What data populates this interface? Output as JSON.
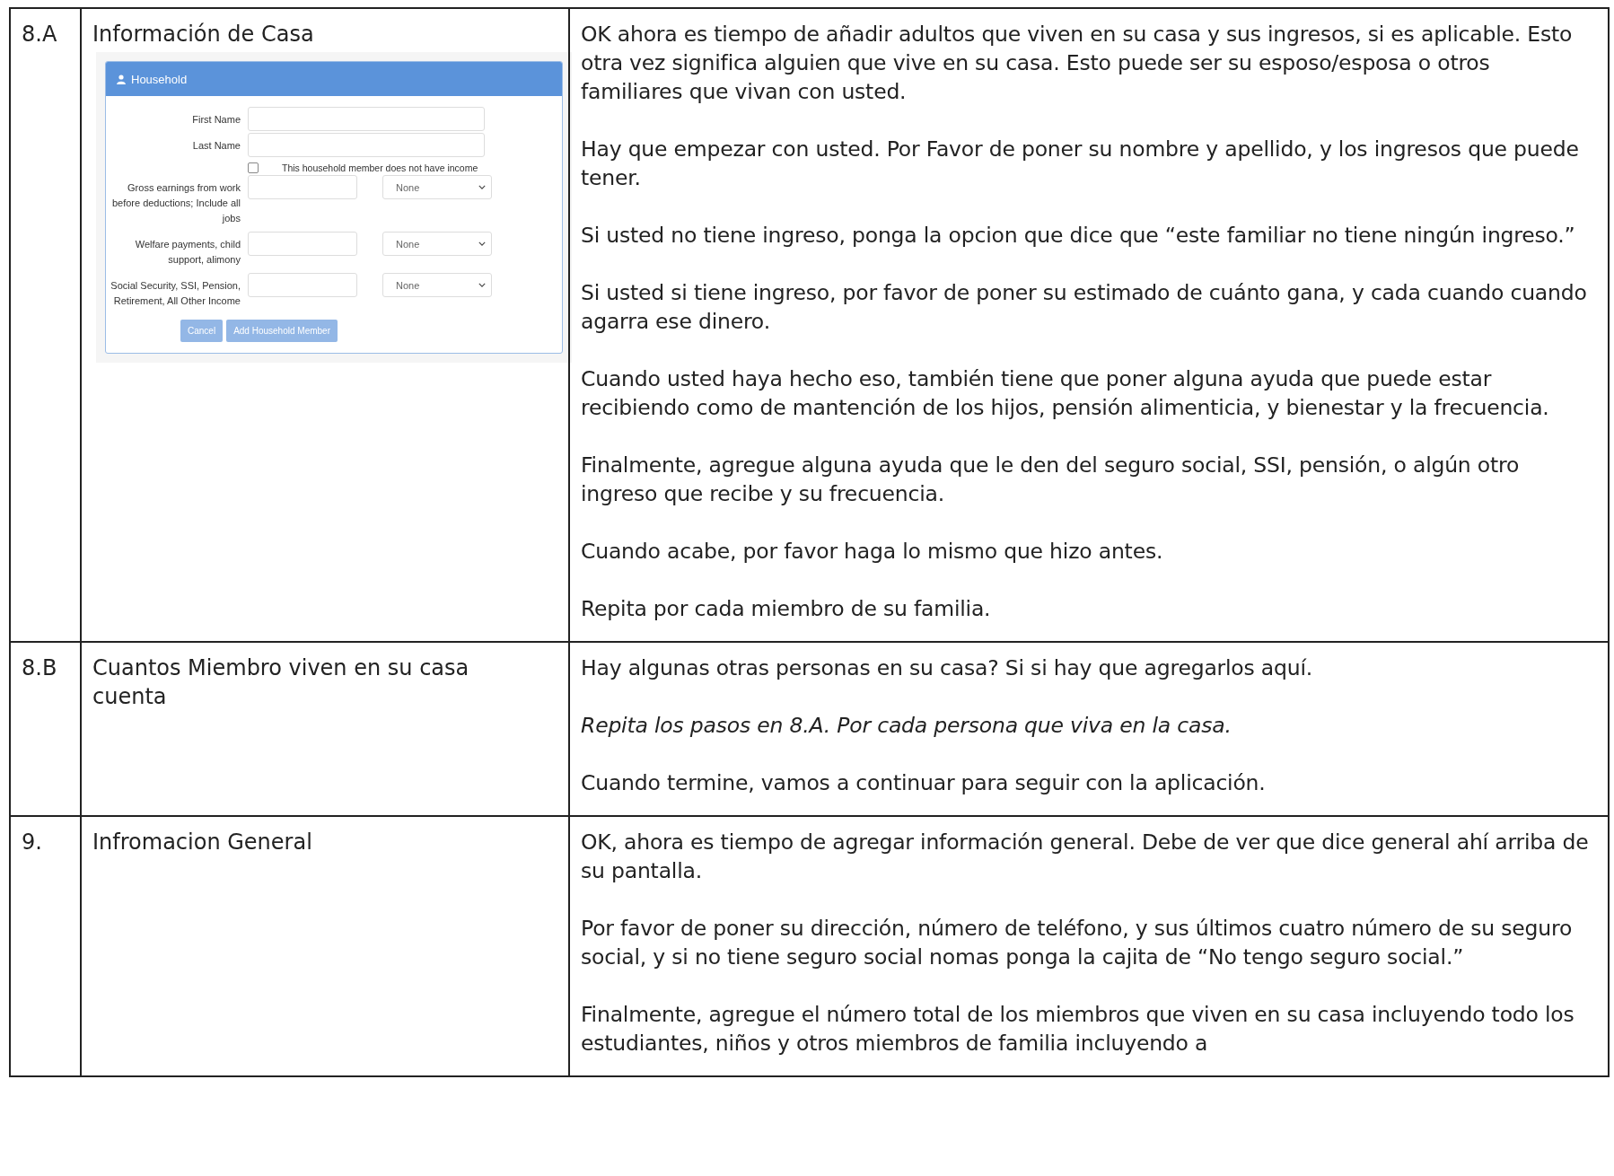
{
  "rows": [
    {
      "number": "8.A",
      "title": "Información de Casa",
      "form": {
        "title": "Household",
        "name_fields": [
          {
            "label": "First Name"
          },
          {
            "label": "Last Name"
          }
        ],
        "no_income_checkbox": {
          "label": "This household member does not have income",
          "checked": false
        },
        "income_fields": [
          {
            "label": "Gross earnings from work before deductions; Include all jobs",
            "frequency": "None"
          },
          {
            "label": "Welfare payments, child support, alimony",
            "frequency": "None"
          },
          {
            "label": "Social Security, SSI, Pension, Retirement, All Other Income",
            "frequency": "None"
          }
        ],
        "buttons": [
          {
            "label": "Cancel",
            "disabled": true
          },
          {
            "label": "Add Household Member",
            "disabled": true
          }
        ]
      },
      "paragraphs": [
        {
          "text": "OK ahora es tiempo de añadir adultos que viven en su casa y sus ingresos, si es aplicable. Esto otra vez significa alguien que vive en su casa. Esto puede ser su esposo/esposa o otros familiares que vivan con usted.",
          "italic": false
        },
        {
          "text": "Hay que empezar con usted. Por Favor de poner su nombre y apellido, y los ingresos que puede tener.",
          "italic": false
        },
        {
          "text": "Si usted no tiene ingreso, ponga la opcion que dice que “este familiar no tiene ningún ingreso.”",
          "italic": false
        },
        {
          "text": "Si usted si tiene ingreso, por favor de poner su estimado de cuánto gana, y cada cuando cuando agarra ese dinero.",
          "italic": false
        },
        {
          "text": "Cuando usted haya hecho eso, también tiene que poner alguna ayuda que puede estar recibiendo como de mantención de los hijos, pensión alimenticia, y bienestar y la frecuencia.",
          "italic": false
        },
        {
          "text": "Finalmente, agregue alguna ayuda que le den del seguro social, SSI, pensión, o algún otro ingreso que recibe y su frecuencia.",
          "italic": false
        },
        {
          "text": "Cuando acabe, por favor haga lo mismo que hizo antes.",
          "italic": false
        },
        {
          "text": "Repita por cada miembro de su familia.",
          "italic": false
        }
      ]
    },
    {
      "number": "8.B",
      "title": "Cuantos Miembro viven en su casa cuenta",
      "paragraphs": [
        {
          "text": "Hay algunas otras personas en su casa? Si si hay que agregarlos aquí.",
          "italic": false
        },
        {
          "text": "Repita los pasos en 8.A. Por cada persona que viva en la casa.",
          "italic": true
        },
        {
          "text": "Cuando termine, vamos a continuar para seguir con la aplicación.",
          "italic": false
        }
      ]
    },
    {
      "number": "9.",
      "title": "Infromacion General",
      "paragraphs": [
        {
          "text": "OK, ahora es tiempo de agregar información general. Debe de ver que dice general ahí arriba de su pantalla.",
          "italic": false
        },
        {
          "text": "Por favor de poner su dirección, número de teléfono, y sus últimos cuatro número de su seguro social, y si no tiene seguro social nomas ponga la cajita de “No tengo seguro social.”",
          "italic": false
        },
        {
          "text": "Finalmente, agregue el número total de los miembros que viven en su casa incluyendo todo los estudiantes, niños y otros miembros de familia incluyendo a",
          "italic": false
        }
      ]
    }
  ]
}
